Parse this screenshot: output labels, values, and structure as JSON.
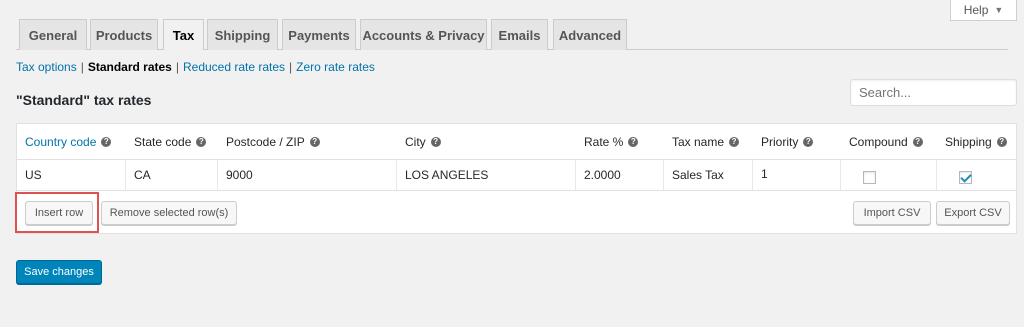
{
  "help": {
    "label": "Help",
    "caret": "▼"
  },
  "tabs": [
    {
      "label": "General"
    },
    {
      "label": "Products"
    },
    {
      "label": "Tax"
    },
    {
      "label": "Shipping"
    },
    {
      "label": "Payments"
    },
    {
      "label": "Accounts & Privacy"
    },
    {
      "label": "Emails"
    },
    {
      "label": "Advanced"
    }
  ],
  "subnav": {
    "tax_options": "Tax options",
    "standard_rates": "Standard rates",
    "reduced_rates": "Reduced rate rates",
    "zero_rates": "Zero rate rates",
    "separator": "|"
  },
  "section_title": "\"Standard\" tax rates",
  "search": {
    "placeholder": "Search..."
  },
  "table": {
    "headers": {
      "country": "Country code",
      "state": "State code",
      "postcode": "Postcode / ZIP",
      "city": "City",
      "rate": "Rate %",
      "tax_name": "Tax name",
      "priority": "Priority",
      "compound": "Compound",
      "shipping": "Shipping"
    },
    "row": {
      "country": "US",
      "state": "CA",
      "postcode": "9000",
      "city": "LOS ANGELES",
      "rate": "2.0000",
      "tax_name": "Sales Tax",
      "priority": "1",
      "compound": false,
      "shipping": true
    },
    "help_glyph": "?"
  },
  "buttons": {
    "insert_row": "Insert row",
    "remove_rows": "Remove selected row(s)",
    "import_csv": "Import CSV",
    "export_csv": "Export CSV",
    "save": "Save changes"
  },
  "colors": {
    "link": "#0073aa",
    "primary": "#0085ba",
    "highlight": "#e05252"
  }
}
